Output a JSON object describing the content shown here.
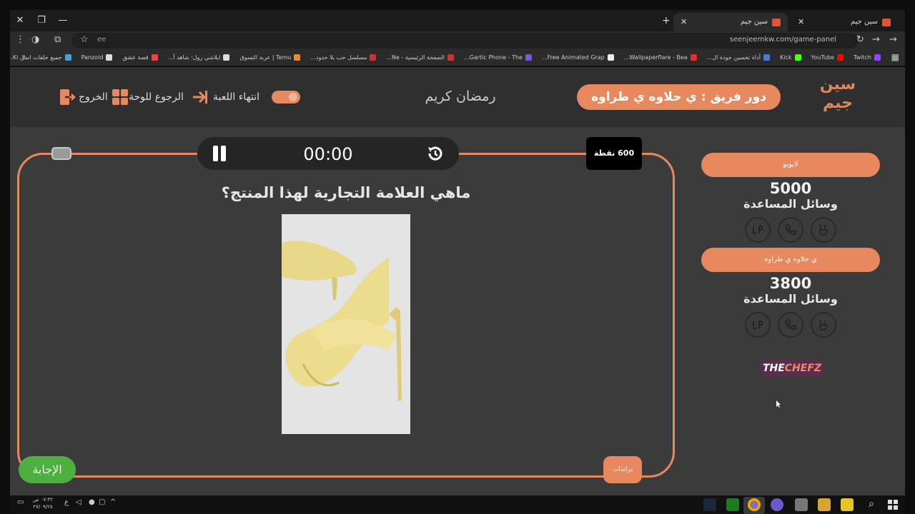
{
  "browser": {
    "tabs": [
      {
        "title": "سين جيم",
        "active": true
      },
      {
        "title": "سين جيم",
        "active": false
      }
    ],
    "url": "seenjeemkw.com/game-panel",
    "site_label": "ee",
    "bookmarks": [
      "Twitch",
      "YouTube",
      "Kick",
      "أداة تحسين جودة ال...",
      "Wallpaperflare - Bea...",
      "Free Animated Grap...",
      "Gartic Phone - The...",
      "الصفحة الرئيسية - Ne...",
      "مسلسل حب بلا حدود...",
      "Temu | عربة التسوق",
      "ايلاشي رول: شاهد أ...",
      "قصة عشق",
      "Panzoid",
      "جميع حلقات انمي Ki..."
    ]
  },
  "header": {
    "logo_line1": "سين",
    "logo_line2": "جيم",
    "turn_label": "دور فريق : ي حلاوه ي طراوه",
    "greeting": "رمضان كريم",
    "end_game": "انتهاء اللعبة",
    "back_to_board": "الرجوع للوحة",
    "exit": "الخروج"
  },
  "game": {
    "timer": "00:00",
    "points": "600 نقطة",
    "question": "ماهي العلامة التجارية لهذا المنتج؟",
    "answer_button": "الإجابة",
    "category_button": "براندات"
  },
  "teams": [
    {
      "name": "لابوبو",
      "score": "5000",
      "aids_label": "وسائل المساعدة"
    },
    {
      "name": "ي حلاوه ي طراوه",
      "score": "3800",
      "aids_label": "وسائل المساعدة"
    }
  ],
  "sponsor": {
    "part1": "THE",
    "part2": "CHEFZ"
  },
  "taskbar": {
    "time": "٠٧:٣٢ ص",
    "date": "٢٧/٠٩/٢٥",
    "lang": "ع"
  },
  "colors": {
    "accent": "#e8885e",
    "answer_green": "#4caf3f",
    "page_bg": "#3b3b3b",
    "header_bg": "#2f2f2f"
  }
}
